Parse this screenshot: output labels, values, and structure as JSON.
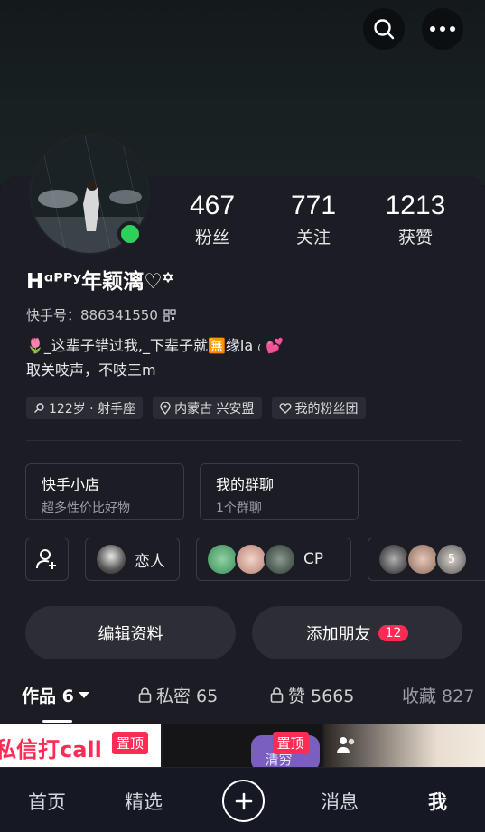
{
  "profile": {
    "nickname": "Hᵅᴾᴾʸ年颖漓♡꙳",
    "id_label": "快手号：886341550",
    "bio_line1": "🌷_这辈子错过我,_下辈子就🈚缘la ₍ 💕",
    "bio_line2": "取关吱声，不吱三m",
    "online": true
  },
  "stats": [
    {
      "value": "467",
      "label": "粉丝"
    },
    {
      "value": "771",
      "label": "关注"
    },
    {
      "value": "1213",
      "label": "获赞"
    }
  ],
  "tags": [
    {
      "icon": "gender-female-icon",
      "label": "122岁 · 射手座"
    },
    {
      "icon": "location-pin-icon",
      "label": "内蒙古 兴安盟"
    },
    {
      "icon": "heart-outline-icon",
      "label": "我的粉丝团"
    }
  ],
  "features": [
    {
      "title": "快手小店",
      "sub": "超多性价比好物"
    },
    {
      "title": "我的群聊",
      "sub": "1个群聊"
    }
  ],
  "relations": {
    "lover_label": "恋人",
    "cp_label": "CP",
    "friends_count": "5"
  },
  "actions": {
    "edit_label": "编辑资料",
    "add_friend_label": "添加朋友",
    "add_friend_badge": "12"
  },
  "tabs": [
    {
      "label": "作品 6",
      "icon": "caret-down-icon"
    },
    {
      "label": "私密 65",
      "icon": "lock-icon"
    },
    {
      "label": "赞 5665",
      "icon": "lock-icon"
    },
    {
      "label": "收藏 827",
      "icon": ""
    }
  ],
  "thumbs": {
    "thumb1_text": "私信打call",
    "thumb2_text": "清穷",
    "pin_label": "置顶"
  },
  "nav": {
    "home": "首页",
    "featured": "精选",
    "messages": "消息",
    "me": "我"
  },
  "colors": {
    "accent": "#fe2c55",
    "online": "#2fd05a",
    "panel": "#1b1c24"
  }
}
